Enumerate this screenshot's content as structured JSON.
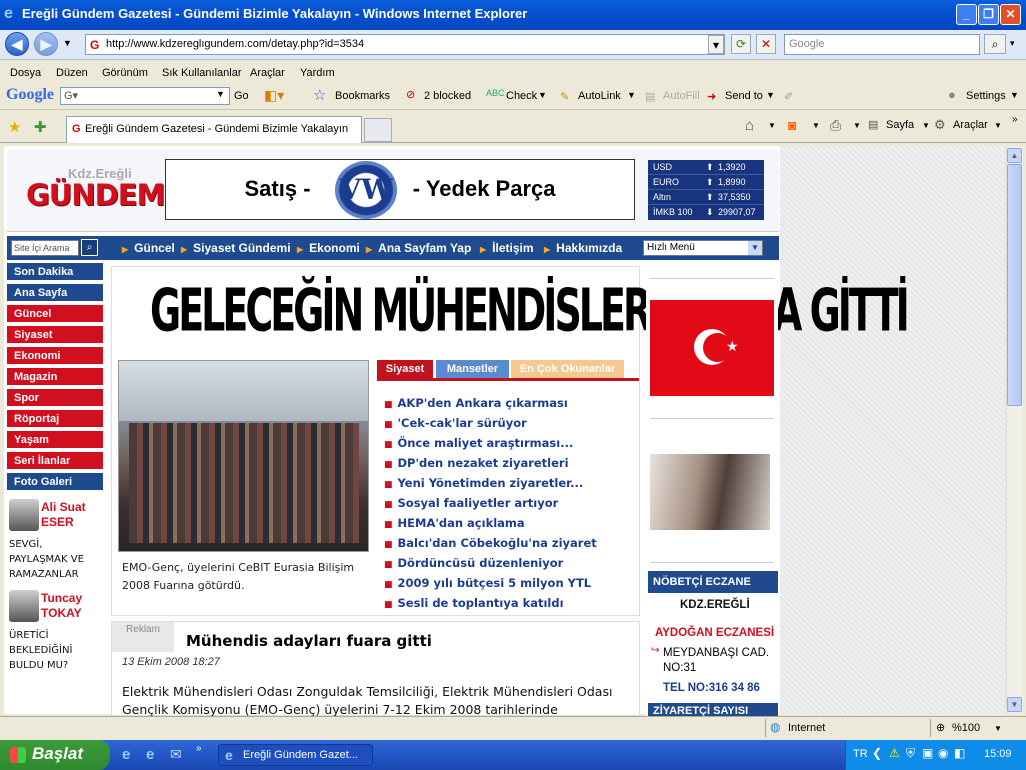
{
  "window": {
    "title": "Ereğli Gündem Gazetesi - Gündemi Bizimle Yakalayın - Windows Internet Explorer"
  },
  "address": {
    "url": "http://www.kdzereglıgundem.com/detay.php?id=3534",
    "search_placeholder": "Google"
  },
  "menu": [
    "Dosya",
    "Düzen",
    "Görünüm",
    "Sık Kullanılanlar",
    "Araçlar",
    "Yardım"
  ],
  "google_toolbar": {
    "brand": "Google",
    "go": "Go",
    "bookmarks": "Bookmarks",
    "blocked": "2 blocked",
    "check": "Check",
    "autolink": "AutoLink",
    "autofill": "AutoFill",
    "sendto": "Send to",
    "settings": "Settings"
  },
  "tabs": {
    "active": "Ereğli Gündem Gazetesi - Gündemi Bizimle Yakalayın",
    "sayfa": "Sayfa",
    "araclar": "Araçlar"
  },
  "header": {
    "logo_small": "Kdz.Ereğli",
    "logo_big": "GÜNDEM",
    "banner_left": "Satış -",
    "banner_right": "- Yedek Parça",
    "rates": [
      {
        "name": "USD",
        "dir": "up",
        "value": "1,3920"
      },
      {
        "name": "EURO",
        "dir": "up",
        "value": "1,8990"
      },
      {
        "name": "Altın",
        "dir": "up",
        "value": "37,5350"
      },
      {
        "name": "İMKB 100",
        "dir": "down",
        "value": "29907,07"
      }
    ]
  },
  "nav": {
    "search_placeholder": "Site İçi Arama",
    "links": [
      "Güncel",
      "Siyaset Gündemi",
      "Ekonomi",
      "Ana Sayfam Yap",
      "İletişim",
      "Hakkımızda"
    ],
    "quick_menu": "Hızlı Menü"
  },
  "left_menu": [
    {
      "label": "Son Dakika",
      "color": "blue"
    },
    {
      "label": "Ana Sayfa",
      "color": "blue"
    },
    {
      "label": "Güncel",
      "color": "red"
    },
    {
      "label": "Siyaset",
      "color": "red"
    },
    {
      "label": "Ekonomi",
      "color": "red"
    },
    {
      "label": "Magazin",
      "color": "red"
    },
    {
      "label": "Spor",
      "color": "red"
    },
    {
      "label": "Röportaj",
      "color": "red"
    },
    {
      "label": "Yaşam",
      "color": "red"
    },
    {
      "label": "Seri İlanlar",
      "color": "red"
    },
    {
      "label": "Foto Galeri",
      "color": "blue"
    }
  ],
  "authors": [
    {
      "first": "Ali Suat",
      "last": "ESER",
      "lines": [
        "SEVGİ,",
        "PAYLAŞMAK VE",
        "RAMAZANLAR"
      ]
    },
    {
      "first": "Tuncay",
      "last": "TOKAY",
      "lines": [
        "ÜRETİCİ",
        "BEKLEDİĞİNİ",
        "BULDU MU?"
      ]
    }
  ],
  "main": {
    "headline": "GELECEĞİN MÜHENDİSLERİ FUARA GİTTİ",
    "caption": "EMO-Genç, üyelerini CeBIT Eurasia Bilişim 2008 Fuarına götürdü.",
    "tabs": [
      "Siyaset",
      "Mansetler",
      "En Çok Okunanlar"
    ],
    "news": [
      "AKP'den Ankara çıkarması",
      "'Cek-cak'lar sürüyor",
      "Önce maliyet araştırması...",
      "DP'den nezaket ziyaretleri",
      "Yeni Yönetimden ziyaretler...",
      "Sosyal faaliyetler artıyor",
      "HEMA'dan açıklama",
      "Balcı'dan Cöbekoğlu'na ziyaret",
      "Dördüncüsü düzenleniyor",
      "2009 yılı bütçesi 5 milyon YTL",
      "Sesli de toplantıya katıldı"
    ]
  },
  "article": {
    "ad": "Reklam",
    "title": "Mühendis adayları fuara gitti",
    "date": "13 Ekim 2008 18:27",
    "body": "Elektrik Mühendisleri Odası Zonguldak Temsilciliği, Elektrik Mühendisleri Odası Gençlik Komisyonu (EMO-Genç) üyelerini 7-12 Ekim 2008 tarihlerinde"
  },
  "right": {
    "pharmacy_header": "NÖBETÇİ ECZANE",
    "city": "KDZ.EREĞLİ",
    "name": "AYDOĞAN ECZANESİ",
    "address": "MEYDANBAŞI CAD. NO:31",
    "phone": "TEL NO:316 34 86",
    "visitors": "ZİYARETÇİ SAYISI"
  },
  "status": {
    "zone": "Internet",
    "zoom": "%100"
  },
  "taskbar": {
    "start": "Başlat",
    "item": "Ereğli Gündem Gazet...",
    "lang": "TR",
    "clock": "15:09"
  }
}
